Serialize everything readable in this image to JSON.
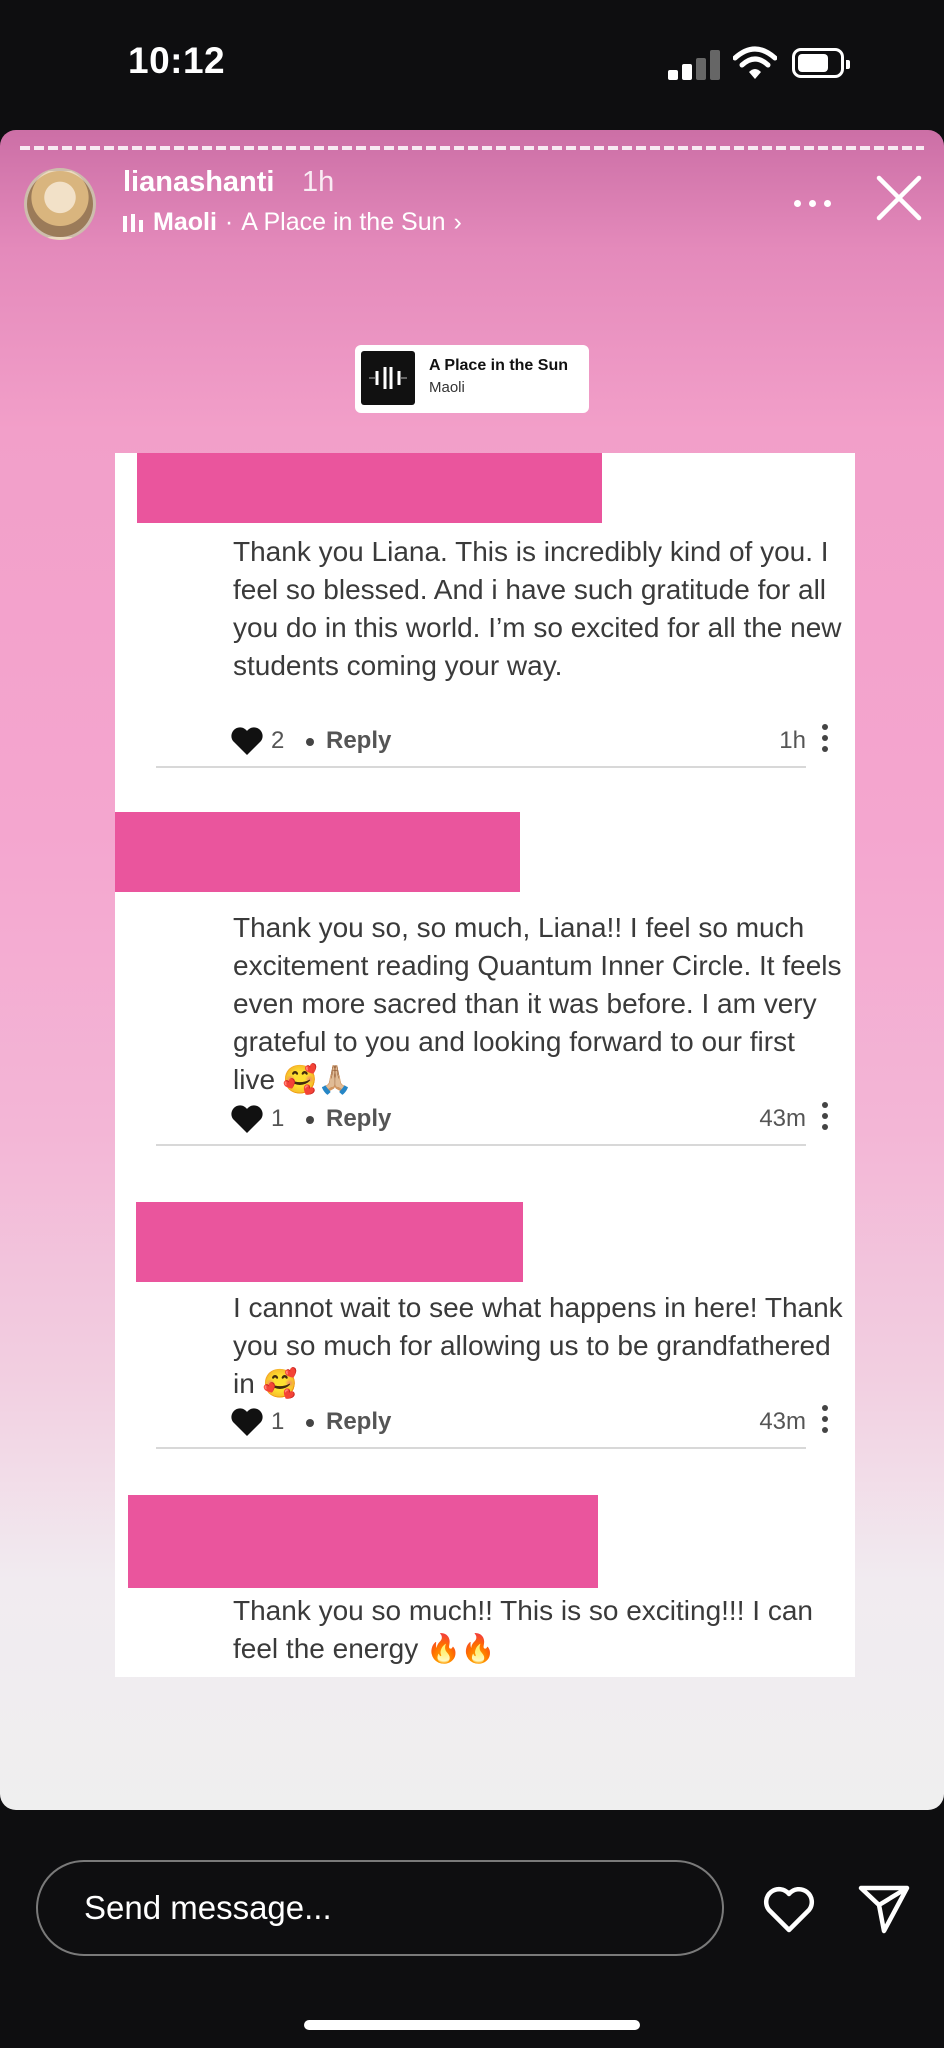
{
  "status_bar": {
    "time": "10:12"
  },
  "story": {
    "username": "lianashanti",
    "posted": "1h",
    "music_artist": "Maoli",
    "music_song": "A Place in the Sun",
    "music_separator": "·",
    "music_chevron": "›"
  },
  "sticker": {
    "title": "A Place in the Sun",
    "artist": "Maoli"
  },
  "comments": [
    {
      "text": "Thank you Liana. This is incredibly kind of you. I feel so blessed. And i have such gratitude for all you do in this world. I’m so excited for all the new students coming your way.",
      "likes": "2",
      "reply": "Reply",
      "time": "1h"
    },
    {
      "text": "Thank you so, so much, Liana!! I feel so much excitement reading Quantum Inner Circle. It feels even more sacred than it was before. I am very grateful to you and looking forward to our first live 🥰🙏🏼",
      "likes": "1",
      "reply": "Reply",
      "time": "43m"
    },
    {
      "text": "I cannot wait to see what happens in here! Thank you so much for allowing us to be grandfathered in 🥰",
      "likes": "1",
      "reply": "Reply",
      "time": "43m"
    },
    {
      "text": "Thank you so much!! This is so exciting!!! I can feel the energy 🔥🔥"
    }
  ],
  "message": {
    "placeholder": "Send message..."
  },
  "colors": {
    "redaction": "#ea559d",
    "story_top": "#cc6fa6",
    "story_bottom": "#efefef"
  },
  "icons": [
    "signal-icon",
    "wifi-icon",
    "battery-icon",
    "more-icon",
    "close-icon",
    "heart-icon",
    "send-icon",
    "music-bars-icon"
  ]
}
